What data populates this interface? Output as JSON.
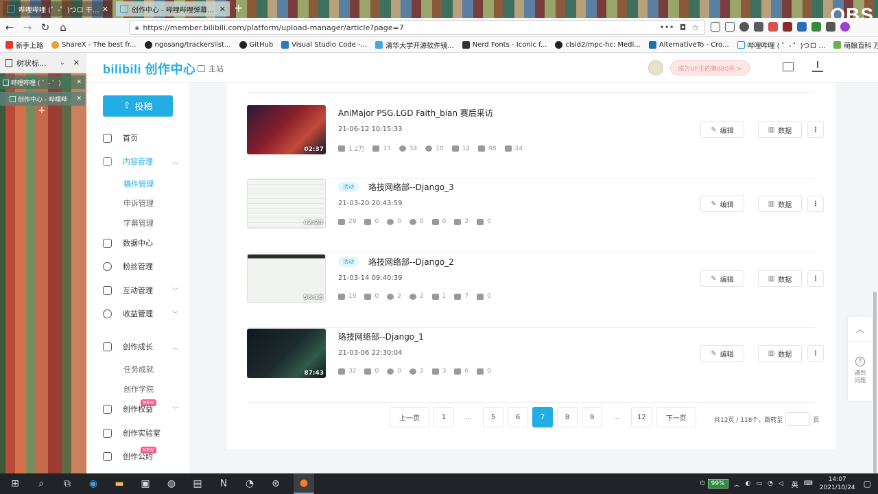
{
  "browser": {
    "tabs": [
      {
        "label": "哔哩哔哩 (゜-゜)つロ 干杯~-bilibili",
        "active": false
      },
      {
        "label": "创作中心 - 哔哩哔哩弹幕视频网",
        "active": true
      }
    ],
    "url": "https://member.bilibili.com/platform/upload-manager/article?page=7",
    "bookmarks": [
      "新手上路",
      "ShareX - The best fr...",
      "ngosang/trackerslist...",
      "GitHub",
      "Visual Studio Code -...",
      "清华大学开源软件镜...",
      "Nerd Fonts - Iconic f...",
      "clsid2/mpc-hc: Medi...",
      "AlternativeTo - Cro...",
      "哔哩哔哩 ( ゜- ゜)つロ ...",
      "萌娘百科 万物皆可萌..."
    ],
    "overlay_text": "OBS"
  },
  "tree_panel": {
    "title": "树状标...",
    "tabs": [
      "哔哩哔哩 ( ゜- ゜)",
      "创作中心 - 哔哩哔"
    ]
  },
  "header": {
    "logo": "bilibili 创作中心",
    "home": "主站",
    "up_pill": "成为UP主的第880天 >"
  },
  "sidebar": {
    "upload": "投稿",
    "items": [
      {
        "label": "首页"
      },
      {
        "label": "内容管理",
        "active": true
      },
      {
        "label": "数据中心"
      },
      {
        "label": "粉丝管理"
      },
      {
        "label": "互动管理"
      },
      {
        "label": "收益管理"
      },
      {
        "label": "创作成长"
      },
      {
        "label": "创作权益",
        "badge": "NEW"
      },
      {
        "label": "创作实验室"
      },
      {
        "label": "创作公约",
        "badge": "NEW"
      }
    ],
    "content_sub": [
      "稿件管理",
      "申诉管理",
      "字幕管理"
    ],
    "growth_sub": [
      "任务成就",
      "创作学院"
    ]
  },
  "videos": [
    {
      "title": "AniMajor PSG.LGD Faith_bian 赛后采访",
      "tag": "",
      "date": "21-06-12 10:15:33",
      "duration": "02:37",
      "thumb_color": "#8a1f2a",
      "stats": [
        "1.2万",
        "13",
        "34",
        "10",
        "12",
        "98",
        "24"
      ]
    },
    {
      "title": "珞技网络部--Django_3",
      "tag": "活动",
      "date": "21-03-20 20:43:59",
      "duration": "42:23",
      "thumb_color": "#e9ece9",
      "stats": [
        "29",
        "0",
        "0",
        "0",
        "0",
        "2",
        "0"
      ]
    },
    {
      "title": "珞技网络部--Django_2",
      "tag": "活动",
      "date": "21-03-14 09:40:39",
      "duration": "56:16",
      "thumb_color": "#eef0ef",
      "stats": [
        "19",
        "0",
        "2",
        "2",
        "1",
        "7",
        "0"
      ]
    },
    {
      "title": "珞技网络部--Django_1",
      "tag": "",
      "date": "21-03-06 22:30:04",
      "duration": "87:43",
      "thumb_color": "#1d2a2e",
      "stats": [
        "32",
        "0",
        "0",
        "2",
        "3",
        "6",
        "0"
      ]
    }
  ],
  "actions": {
    "edit": "编辑",
    "data": "数据"
  },
  "pagination": {
    "prev": "上一页",
    "next": "下一页",
    "pages": [
      "1",
      "...",
      "5",
      "6",
      "7",
      "8",
      "9",
      "...",
      "12"
    ],
    "current": "7",
    "info": "共12页 / 118个，跳转至",
    "suffix": "页"
  },
  "float": {
    "help": "遇到\n问题"
  },
  "taskbar": {
    "battery": "99%",
    "lang": "英",
    "time": "14:07",
    "date": "2021/10/24"
  }
}
